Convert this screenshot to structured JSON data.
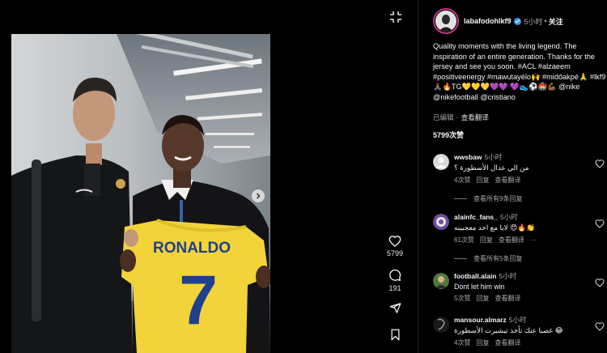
{
  "post": {
    "username": "labafodohlkf9",
    "time": "5小时",
    "separator": "•",
    "follow_label": "关注",
    "caption": "Quality moments with the living legend. The inspiration of an entire generation. Thanks for the jersey and see you soon. #ACL #alzaeem #positiveenergy #mawutayélo🙌 #midôakpé🙏 #lkf9🙏🏾🔥TG💛💛💛💜💜 💜👟⚽🏟️💪🏾 @nike @nikefootball @cristiano",
    "edited_label": "已编辑 ·",
    "translate_label": "查看翻译",
    "likes_label": "5799次赞",
    "like_count": "5799",
    "comment_count": "191",
    "jersey_name": "RONALDO",
    "jersey_number": "7"
  },
  "comments": [
    {
      "user": "wwsbaw",
      "time": "5小时",
      "text": "من الي عدال الأسطورة ؟",
      "likes": "4次赞",
      "reply": "回复",
      "translate": "查看翻译",
      "more_replies": "查看所有9条回复",
      "avatar_color": "#d8d8d8"
    },
    {
      "user": "alainfc_fans_",
      "time": "5小时",
      "text": "لابا مع احد معجبينه 😍🔥👏",
      "likes": "61次赞",
      "reply": "回复",
      "translate": "查看翻译",
      "more_label": "···",
      "more_replies": "查看所有5条回复",
      "avatar_color": "#6b4ea0"
    },
    {
      "user": "football.alain",
      "time": "5小时",
      "text": "Dont let him win",
      "likes": "5次赞",
      "reply": "回复",
      "translate": "查看翻译",
      "avatar_color": "#4f7a3a"
    },
    {
      "user": "mansour.almarz",
      "time": "5小时",
      "text": "غصبا عنك تأخذ تيشيرت الأسطورة 😂",
      "likes": "4次赞",
      "reply": "回复",
      "translate": "查看翻译",
      "avatar_color": "#1a1a1a"
    }
  ],
  "icons": {
    "expand": "expand-icon",
    "next": "chevron-right-icon",
    "like": "heart-icon",
    "comment": "comment-icon",
    "share": "paper-plane-icon",
    "save": "bookmark-icon"
  },
  "colors": {
    "background": "#000000",
    "verified": "#3897f0",
    "jersey": "#f2d43a",
    "jersey_text": "#1f3f8f"
  }
}
